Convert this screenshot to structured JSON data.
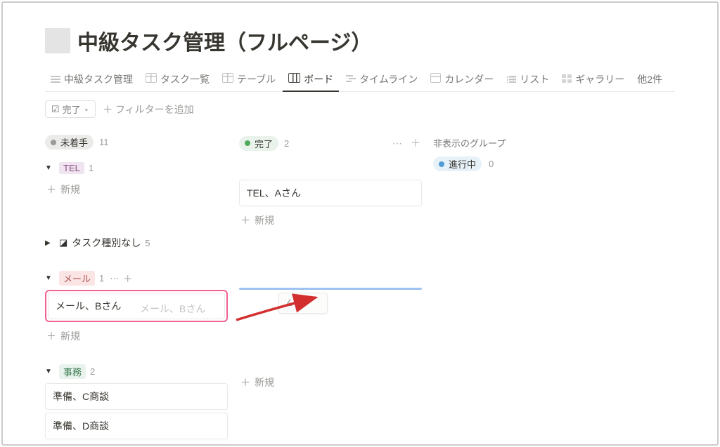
{
  "page": {
    "title": "中級タスク管理（フルページ）"
  },
  "tabs": [
    {
      "label": "中級タスク管理",
      "icon": "ico-list"
    },
    {
      "label": "タスク一覧",
      "icon": "ico-table"
    },
    {
      "label": "テーブル",
      "icon": "ico-table"
    },
    {
      "label": "ボード",
      "icon": "ico-board",
      "active": true
    },
    {
      "label": "タイムライン",
      "icon": "ico-timeline"
    },
    {
      "label": "カレンダー",
      "icon": "ico-calendar"
    },
    {
      "label": "リスト",
      "icon": "ico-simplelist"
    },
    {
      "label": "ギャラリー",
      "icon": "ico-gallery"
    }
  ],
  "tabs_overflow": "他2件",
  "filter": {
    "done_label": "完了",
    "add_filter": "フィルターを追加",
    "plus": "＋"
  },
  "columns": {
    "col1": {
      "label": "未着手",
      "count": "11"
    },
    "col2": {
      "label": "完了",
      "count": "2"
    }
  },
  "hidden_group": {
    "title": "非表示のグループ",
    "item_label": "進行中",
    "item_count": "0"
  },
  "groups": {
    "tel": {
      "label": "TEL",
      "count": "1",
      "card": "TEL、Aさん"
    },
    "none": {
      "label": "タスク種別なし",
      "count": "5"
    },
    "mail": {
      "label": "メール",
      "count": "1",
      "card_main": "メール、Bさん",
      "card_ghost": "メール、Bさん"
    },
    "jimu": {
      "label": "事務",
      "count": "2",
      "card1": "準備、C商談",
      "card2": "準備、D商談"
    }
  },
  "common": {
    "new": "新規",
    "plus": "＋",
    "dots": "⋯"
  }
}
